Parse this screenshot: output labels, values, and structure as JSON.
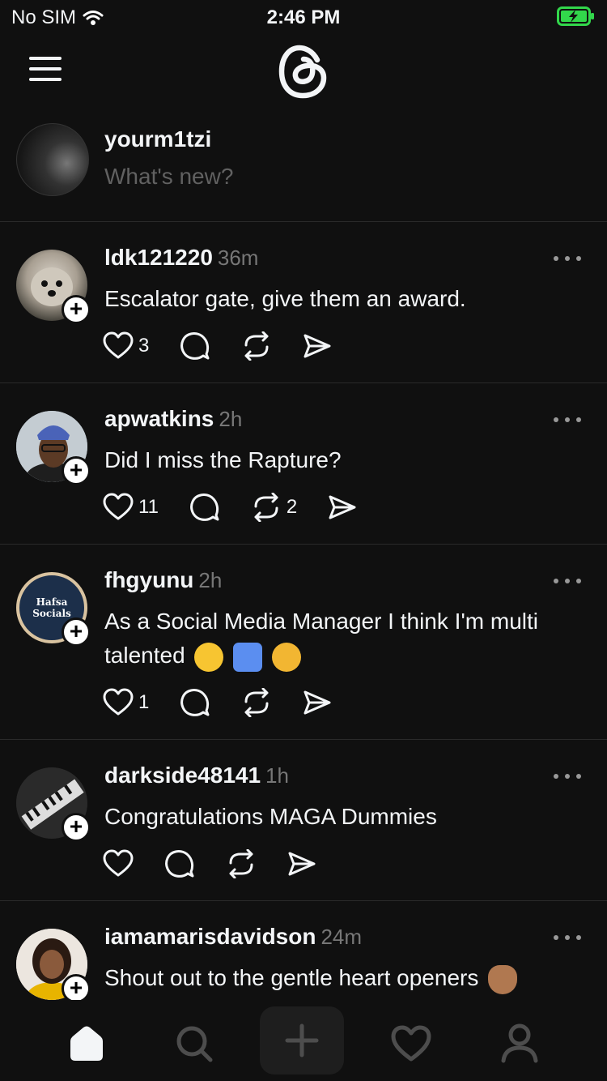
{
  "status": {
    "carrier": "No SIM",
    "time": "2:46 PM"
  },
  "composer": {
    "username": "yourm1tzi",
    "placeholder": "What's new?"
  },
  "posts": [
    {
      "user": "ldk121220",
      "time": "36m",
      "text": "Escalator gate, give them an award.",
      "likes": "3",
      "replies": "",
      "reposts": ""
    },
    {
      "user": "apwatkins",
      "time": "2h",
      "text": "Did I miss the Rapture?",
      "likes": "11",
      "replies": "",
      "reposts": "2"
    },
    {
      "user": "fhgyunu",
      "time": "2h",
      "text": "As a Social Media Manager I think I'm multi talented",
      "likes": "1",
      "replies": "",
      "reposts": "",
      "avatar_label": "Hafsa Socials"
    },
    {
      "user": "darkside48141",
      "time": "1h",
      "text": "Congratulations MAGA Dummies",
      "likes": "",
      "replies": "",
      "reposts": ""
    },
    {
      "user": "iamamarisdavidson",
      "time": "24m",
      "text": "Shout out to the gentle heart openers",
      "likes": "",
      "replies": "",
      "reposts": ""
    }
  ],
  "icons": {
    "menu": "menu-icon",
    "logo": "threads-logo",
    "like": "heart-icon",
    "reply": "comment-icon",
    "repost": "repost-icon",
    "share": "send-icon",
    "home": "home-icon",
    "search": "search-icon",
    "new": "plus-icon",
    "activity": "heart-icon",
    "profile": "profile-icon"
  },
  "colors": {
    "background": "#101010",
    "text": "#f3f5f7",
    "muted": "#777777",
    "battery": "#32d74b"
  }
}
